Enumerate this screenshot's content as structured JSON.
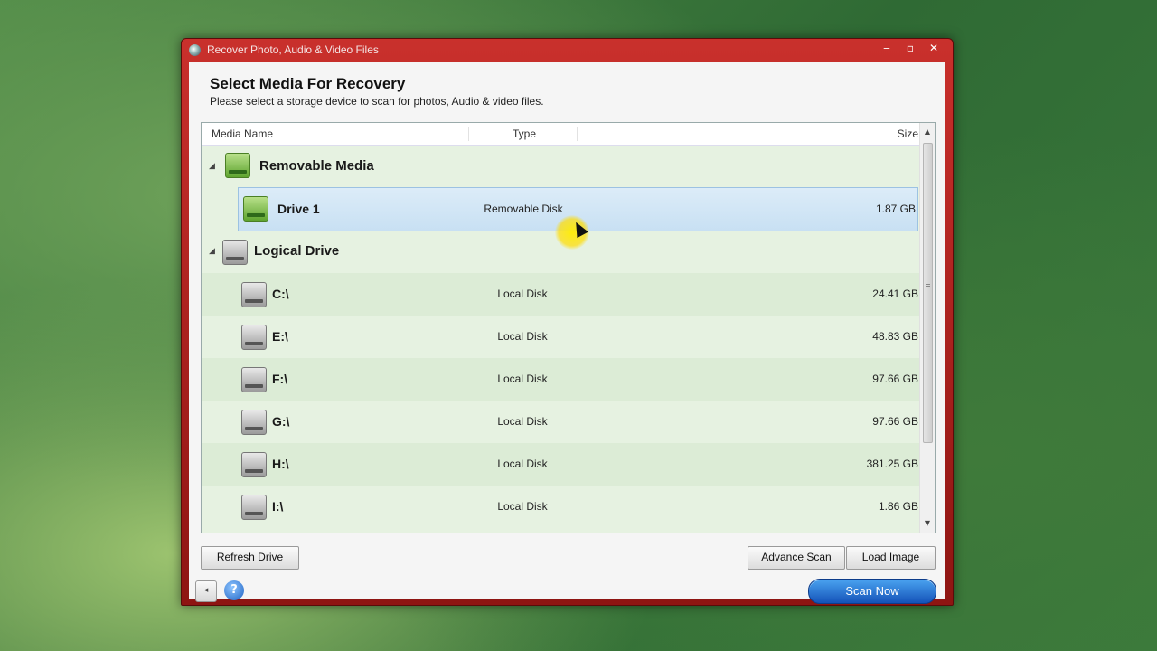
{
  "window": {
    "title": "Recover Photo, Audio & Video Files",
    "controls": {
      "minimize": "‒",
      "maximize": "▫",
      "close": "✕"
    }
  },
  "header": {
    "title": "Select Media For Recovery",
    "subtitle": "Please select a storage device to scan for photos, Audio & video files."
  },
  "columns": {
    "name": "Media Name",
    "type": "Type",
    "size": "Size"
  },
  "groups": [
    {
      "label": "Removable Media",
      "icon": "removable-drive-icon",
      "drives": [
        {
          "name": "Drive 1",
          "type": "Removable Disk",
          "size": "1.87 GB",
          "selected": true
        }
      ]
    },
    {
      "label": "Logical Drive",
      "icon": "hard-drive-icon",
      "drives": [
        {
          "name": "C:\\",
          "type": "Local Disk",
          "size": "24.41 GB"
        },
        {
          "name": "E:\\",
          "type": "Local Disk",
          "size": "48.83 GB"
        },
        {
          "name": "F:\\",
          "type": "Local Disk",
          "size": "97.66 GB"
        },
        {
          "name": "G:\\",
          "type": "Local Disk",
          "size": "97.66 GB"
        },
        {
          "name": "H:\\",
          "type": "Local Disk",
          "size": "381.25 GB"
        },
        {
          "name": "I:\\",
          "type": "Local Disk",
          "size": "1.86 GB"
        }
      ]
    }
  ],
  "toggle_glyph": "◢",
  "buttons": {
    "refresh": "Refresh Drive",
    "advance_scan": "Advance Scan",
    "load_image": "Load Image",
    "scan_now": "Scan Now",
    "help": "?",
    "back": "◂"
  },
  "colors": {
    "title_bar": "#b3231f",
    "list_background": "#e6f2e1",
    "selected_row": "#c8e0f3",
    "scan_button": "#1c6ed6"
  }
}
